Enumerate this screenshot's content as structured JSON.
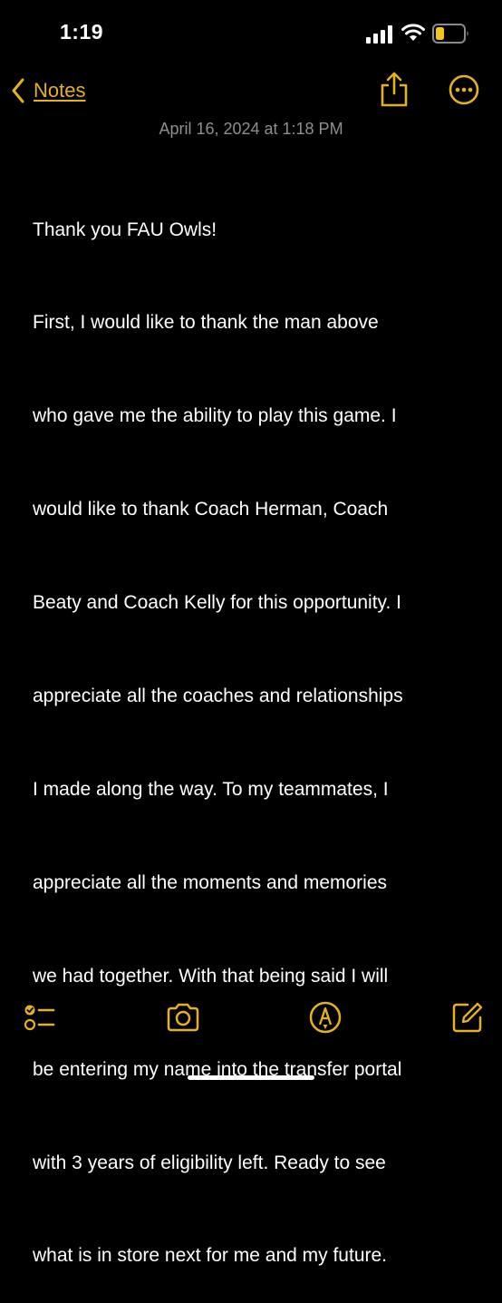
{
  "status_bar": {
    "time": "1:19",
    "icons": [
      "cellular-signal-icon",
      "wifi-icon",
      "battery-low-icon"
    ],
    "battery_color": "#F5C518"
  },
  "nav": {
    "back_label": "Notes",
    "actions": [
      "share-icon",
      "more-options-icon"
    ],
    "accent_color": "#E5B21B"
  },
  "note": {
    "date": "April 16, 2024 at 1:18 PM",
    "lines": [
      "Thank you FAU Owls!",
      "First, I would like to thank the man above",
      "who gave me the ability to play this game. I",
      "would like to thank Coach Herman, Coach",
      "Beaty and Coach Kelly for this opportunity. I",
      "appreciate all the coaches and relationships",
      "I made along the way. To my teammates, I",
      "appreciate all the moments and memories",
      "we had together. With that being said I will",
      "be entering my name into the transfer portal",
      "with 3 years of eligibility left. Ready to see",
      "what is in store next for me and my future."
    ]
  },
  "toolbar": {
    "items": [
      "checklist-icon",
      "camera-icon",
      "markup-pen-icon",
      "compose-icon"
    ]
  }
}
